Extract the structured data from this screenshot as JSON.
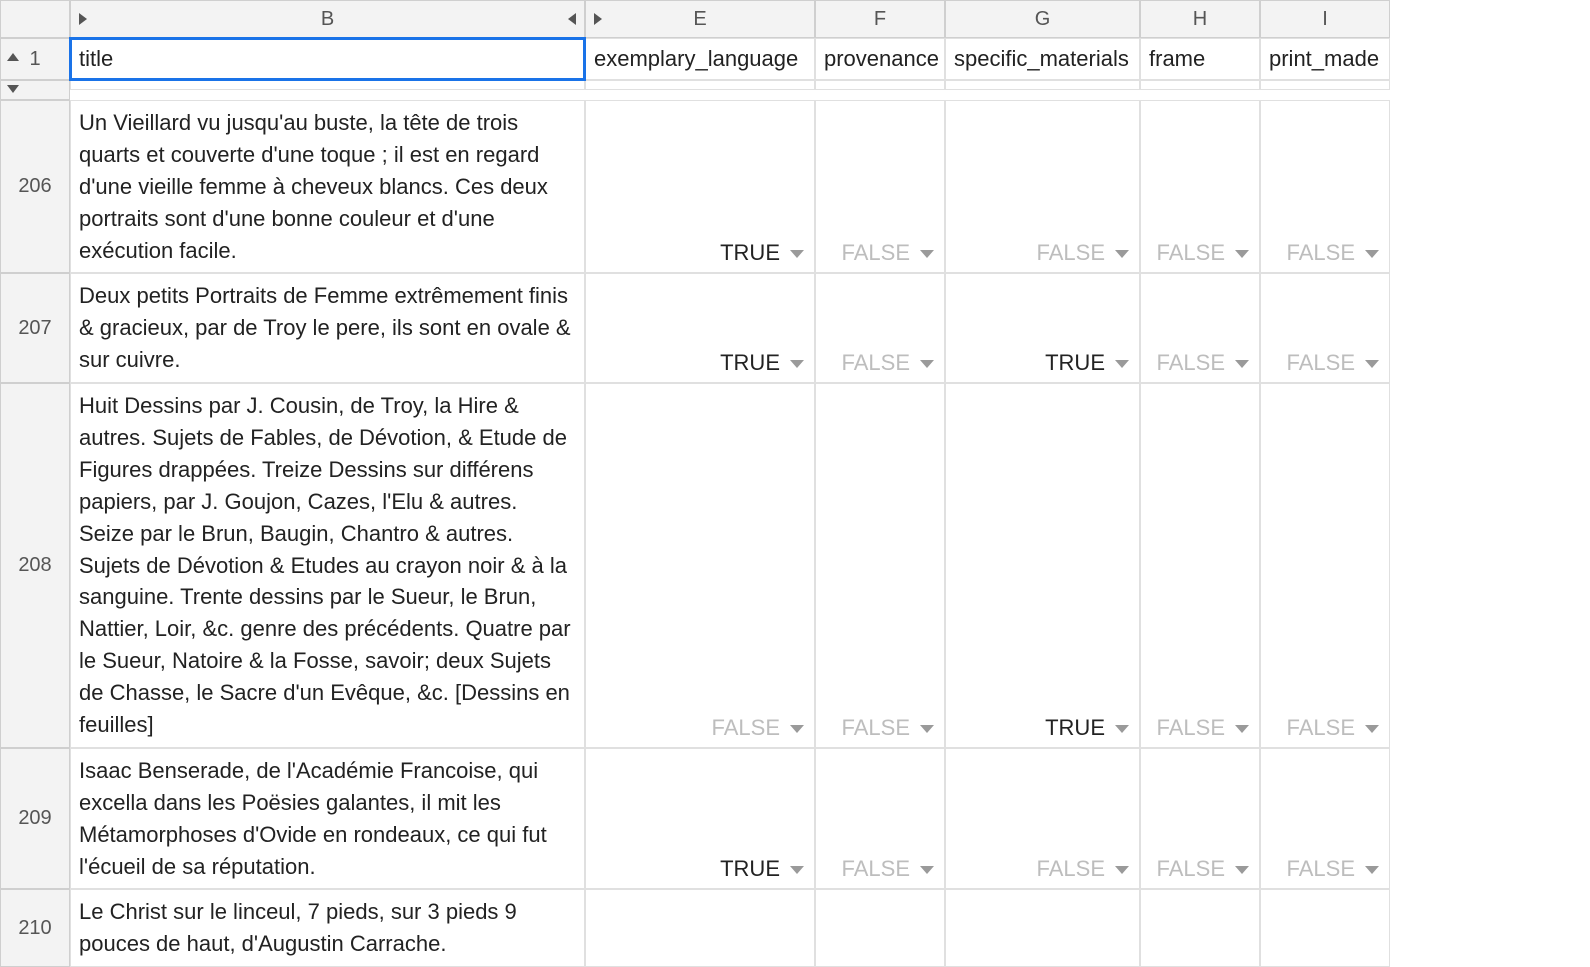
{
  "columns": {
    "B": "B",
    "E": "E",
    "F": "F",
    "G": "G",
    "H": "H",
    "I": "I"
  },
  "headerRow": {
    "num": "1",
    "B": "title",
    "E": "exemplary_language",
    "F": "provenance",
    "G": "specific_materials",
    "H": "frame",
    "I": "print_made"
  },
  "rows": [
    {
      "num": "206",
      "title": "Un Vieillard vu jusqu'au buste, la tête de trois quarts et couverte d'une toque ; il est en regard d'une vieille femme à cheveux blancs. Ces deux portraits sont d'une bonne couleur et d'une exécution facile.",
      "E": "TRUE",
      "F": "FALSE",
      "G": "FALSE",
      "H": "FALSE",
      "I": "FALSE"
    },
    {
      "num": "207",
      "title": "Deux petits Portraits de Femme extrêmement finis & gracieux, par de Troy le pere, ils sont en ovale & sur cuivre.",
      "E": "TRUE",
      "F": "FALSE",
      "G": "TRUE",
      "H": "FALSE",
      "I": "FALSE"
    },
    {
      "num": "208",
      "title": "Huit Dessins par J. Cousin, de Troy, la Hire & autres. Sujets de Fables, de Dévotion, & Etude de Figures drappées. Treize Dessins sur différens papiers, par J. Goujon, Cazes, l'Elu & autres. Seize par le Brun, Baugin, Chantro & autres. Sujets de Dévotion & Etudes au crayon noir & à la sanguine. Trente dessins par le Sueur, le Brun, Nattier, Loir, &c. genre des précédents. Quatre par le Sueur, Natoire & la Fosse, savoir; deux Sujets de Chasse, le Sacre d'un Evêque, &c. [Dessins en feuilles]",
      "E": "FALSE",
      "F": "FALSE",
      "G": "TRUE",
      "H": "FALSE",
      "I": "FALSE"
    },
    {
      "num": "209",
      "title": "Isaac Benserade, de l'Académie Francoise, qui excella dans les Poësies galantes, il mit les Métamorphoses d'Ovide en rondeaux, ce qui fut l'écueil de sa réputation.",
      "E": "TRUE",
      "F": "FALSE",
      "G": "FALSE",
      "H": "FALSE",
      "I": "FALSE"
    },
    {
      "num": "210",
      "title": "Le Christ sur le linceul, 7 pieds, sur 3 pieds 9 pouces de haut, d'Augustin Carrache.",
      "E": "",
      "F": "",
      "G": "",
      "H": "",
      "I": ""
    }
  ]
}
